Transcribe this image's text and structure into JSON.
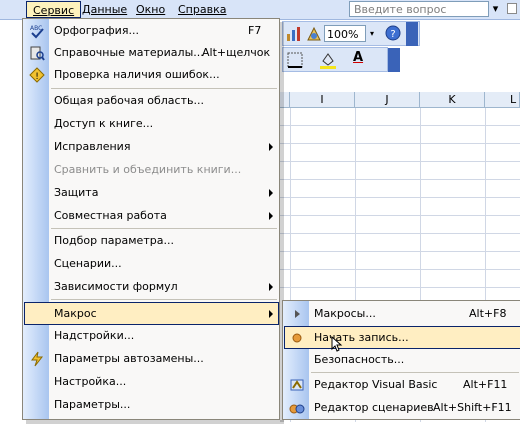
{
  "menubar": {
    "items": [
      "Сервис",
      "Данные",
      "Окно",
      "Справка"
    ],
    "ask_placeholder": "Введите вопрос",
    "ask_arrow": "▾"
  },
  "toolbar": {
    "zoom": "100%",
    "zoom_arrow": "▾",
    "font_color_letter": "A"
  },
  "columns": [
    "I",
    "J",
    "K",
    "L"
  ],
  "service_menu": {
    "items": [
      {
        "label": "Орфография...",
        "shortcut": "F7",
        "icon": "spellcheck-icon"
      },
      {
        "label": "Справочные материалы...",
        "shortcut": "Alt+щелчок",
        "icon": "research-icon"
      },
      {
        "label": "Проверка наличия ошибок...",
        "icon": "error-check-icon"
      },
      {
        "label": "Общая рабочая область..."
      },
      {
        "label": "Доступ к книге..."
      },
      {
        "label": "Исправления",
        "submenu": true
      },
      {
        "label": "Сравнить и объединить книги...",
        "disabled": true
      },
      {
        "label": "Защита",
        "submenu": true
      },
      {
        "label": "Совместная работа",
        "submenu": true
      },
      {
        "label": "Подбор параметра..."
      },
      {
        "label": "Сценарии..."
      },
      {
        "label": "Зависимости формул",
        "submenu": true
      },
      {
        "label": "Макрос",
        "submenu": true,
        "highlighted": true
      },
      {
        "label": "Надстройки..."
      },
      {
        "label": "Параметры автозамены...",
        "icon": "autocorrect-icon"
      },
      {
        "label": "Настройка..."
      },
      {
        "label": "Параметры..."
      }
    ]
  },
  "macro_menu": {
    "items": [
      {
        "label": "Макросы...",
        "shortcut": "Alt+F8",
        "icon": "run-macro-icon"
      },
      {
        "label": "Начать запись...",
        "icon": "record-icon",
        "highlighted": true
      },
      {
        "label": "Безопасность..."
      },
      {
        "label": "Редактор Visual Basic",
        "shortcut": "Alt+F11",
        "icon": "vb-editor-icon"
      },
      {
        "label": "Редактор сценариев",
        "shortcut": "Alt+Shift+F11",
        "icon": "script-editor-icon"
      }
    ]
  }
}
